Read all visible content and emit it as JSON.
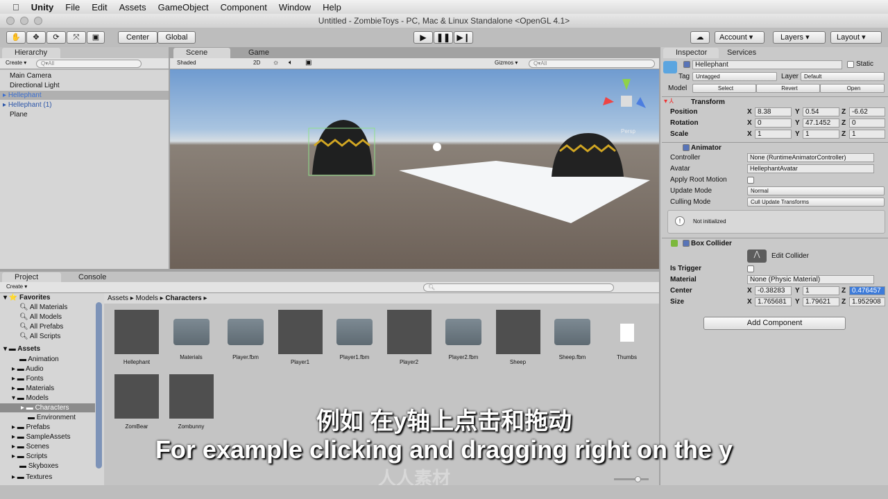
{
  "menu": {
    "app": "Unity",
    "items": [
      "File",
      "Edit",
      "Assets",
      "GameObject",
      "Component",
      "Window",
      "Help"
    ]
  },
  "window_title": "Untitled - ZombieToys - PC, Mac & Linux Standalone <OpenGL 4.1>",
  "toolbar": {
    "pivot": "Center",
    "space": "Global",
    "account": "Account",
    "layers": "Layers",
    "layout": "Layout",
    "tools": [
      "hand-icon",
      "move-icon",
      "rotate-icon",
      "scale-icon",
      "rect-icon"
    ]
  },
  "hierarchy": {
    "tab": "Hierarchy",
    "create": "Create",
    "search_placeholder": "Q▾All",
    "items": [
      "Main Camera",
      "Directional Light",
      "Hellephant",
      "Hellephant (1)",
      "Plane"
    ]
  },
  "scene": {
    "tab_scene": "Scene",
    "tab_game": "Game",
    "shading": "Shaded",
    "mode2d": "2D",
    "gizmos": "Gizmos",
    "search_placeholder": "Q▾All",
    "gizmo_label": "Persp"
  },
  "inspector": {
    "tab": "Inspector",
    "tab_services": "Services",
    "object_name": "Hellephant",
    "static": "Static",
    "tag_label": "Tag",
    "tag": "Untagged",
    "layer_label": "Layer",
    "layer": "Default",
    "model_label": "Model",
    "select": "Select",
    "revert": "Revert",
    "open": "Open",
    "transform": {
      "title": "Transform",
      "position": {
        "label": "Position",
        "x": "8.38",
        "y": "0.54",
        "z": "-6.62"
      },
      "rotation": {
        "label": "Rotation",
        "x": "0",
        "y": "47.1452",
        "z": "0"
      },
      "scale": {
        "label": "Scale",
        "x": "1",
        "y": "1",
        "z": "1"
      }
    },
    "animator": {
      "title": "Animator",
      "controller_label": "Controller",
      "controller": "None (RuntimeAnimatorController)",
      "avatar_label": "Avatar",
      "avatar": "HellephantAvatar",
      "root_motion": "Apply Root Motion",
      "update_label": "Update Mode",
      "update": "Normal",
      "culling_label": "Culling Mode",
      "culling": "Cull Update Transforms",
      "notice": "Not initialized"
    },
    "box_collider": {
      "title": "Box Collider",
      "edit": "Edit Collider",
      "trigger": "Is Trigger",
      "material_label": "Material",
      "material": "None (Physic Material)",
      "center": {
        "label": "Center",
        "x": "-0.38283",
        "y": "1",
        "z": "0.476457"
      },
      "size": {
        "label": "Size",
        "x": "1.765681",
        "y": "1.79621",
        "z": "1.952908"
      }
    },
    "add_component": "Add Component"
  },
  "project": {
    "tab": "Project",
    "tab_console": "Console",
    "create": "Create",
    "favorites": {
      "label": "Favorites",
      "items": [
        "All Materials",
        "All Models",
        "All Prefabs",
        "All Scripts"
      ]
    },
    "assets": {
      "label": "Assets",
      "items": [
        "Animation",
        "Audio",
        "Fonts",
        "Materials",
        "Models",
        "Characters",
        "Environment",
        "Prefabs",
        "SampleAssets",
        "Scenes",
        "Scripts",
        "Skyboxes",
        "Textures"
      ]
    },
    "breadcrumb": [
      "Assets",
      "Models",
      "Characters"
    ],
    "files": [
      {
        "name": "Hellephant",
        "kind": "model"
      },
      {
        "name": "Materials",
        "kind": "folder"
      },
      {
        "name": "Player.fbm",
        "kind": "folder"
      },
      {
        "name": "Player1",
        "kind": "model"
      },
      {
        "name": "Player1.fbm",
        "kind": "folder"
      },
      {
        "name": "Player2",
        "kind": "model"
      },
      {
        "name": "Player2.fbm",
        "kind": "folder"
      },
      {
        "name": "Sheep",
        "kind": "model"
      },
      {
        "name": "Sheep.fbm",
        "kind": "folder"
      },
      {
        "name": "Thumbs",
        "kind": "file"
      },
      {
        "name": "ZomBear",
        "kind": "model"
      },
      {
        "name": "Zombunny",
        "kind": "model"
      }
    ]
  },
  "subtitles": {
    "zh": "例如  在y轴上点击和拖动",
    "en": "For example clicking and dragging right on the y"
  },
  "watermark": "人人素材"
}
